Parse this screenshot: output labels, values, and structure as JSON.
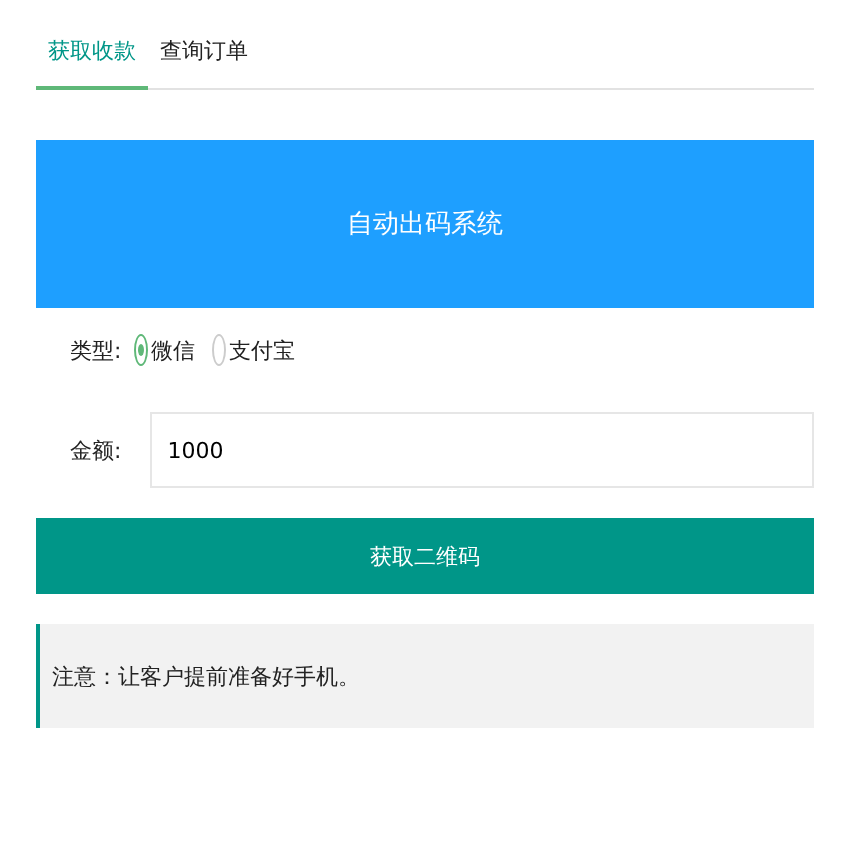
{
  "tabs": [
    {
      "label": "获取收款",
      "selected": true
    },
    {
      "label": "查询订单",
      "selected": false
    }
  ],
  "banner": {
    "title": "自动出码系统"
  },
  "type_field": {
    "label": "类型:",
    "options": [
      {
        "label": "微信",
        "selected": true
      },
      {
        "label": "支付宝",
        "selected": false
      }
    ]
  },
  "amount_field": {
    "label": "金额:",
    "value": "1000"
  },
  "submit_button": {
    "label": "获取二维码"
  },
  "note": {
    "text": "注意：让客户提前准备好手机。"
  }
}
